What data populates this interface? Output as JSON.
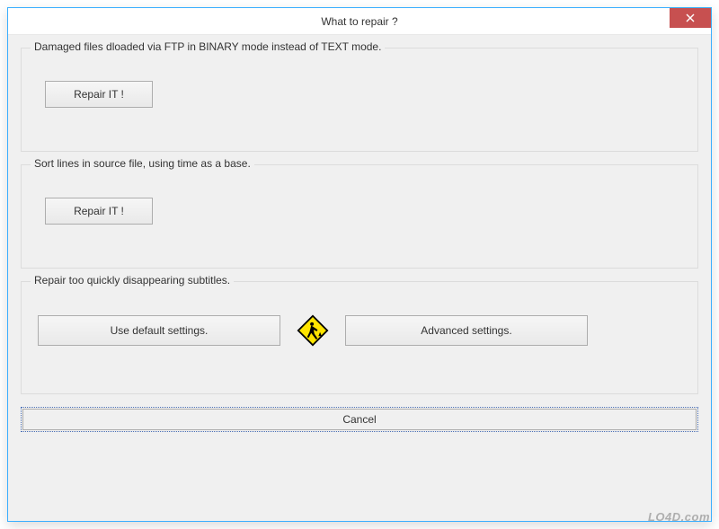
{
  "window": {
    "title": "What to repair ?"
  },
  "groups": {
    "ftp": {
      "label": "Damaged files dloaded via FTP in BINARY mode instead of TEXT mode.",
      "button": "Repair IT !"
    },
    "sort": {
      "label": "Sort lines in source file, using time as a base.",
      "button": "Repair IT !"
    },
    "subtitles": {
      "label": "Repair too quickly disappearing subtitles.",
      "default_btn": "Use default settings.",
      "advanced_btn": "Advanced settings."
    }
  },
  "cancel": "Cancel",
  "watermark": "LO4D.com",
  "icons": {
    "close": "close-icon",
    "work_sign": "construction-sign-icon"
  },
  "colors": {
    "border": "#39aeff",
    "close_bg": "#c75050",
    "panel_bg": "#f0f0f0",
    "sign_yellow": "#ffe400"
  }
}
